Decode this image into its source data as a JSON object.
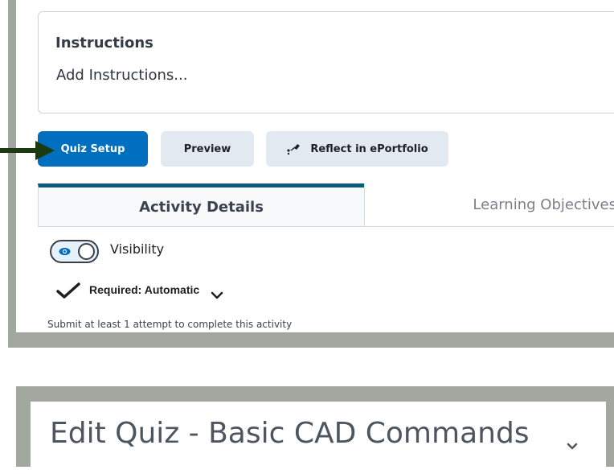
{
  "instructions": {
    "heading": "Instructions",
    "link": "Add Instructions..."
  },
  "toolbar": {
    "quiz_setup_label": "Quiz Setup",
    "preview_label": "Preview",
    "reflect_label": "Reflect in ePortfolio"
  },
  "tabs": [
    {
      "label": "Activity Details",
      "active": true
    },
    {
      "label": "Learning Objectives",
      "active": false
    }
  ],
  "activity": {
    "visibility_label": "Visibility",
    "visibility_on": true,
    "required_label": "Required: Automatic",
    "submit_text": "Submit at least 1 attempt to complete this activity"
  },
  "header": {
    "title": "Edit Quiz - Basic CAD Commands"
  },
  "colors": {
    "primary": "#006fbf",
    "tab_accent": "#0b5d7c",
    "frame": "#a2a79f",
    "arrow": "#1b3a10"
  },
  "icons": [
    "arrow-right-icon",
    "eportfolio-icon",
    "eye-icon",
    "checkmark-icon",
    "chevron-down-icon"
  ]
}
